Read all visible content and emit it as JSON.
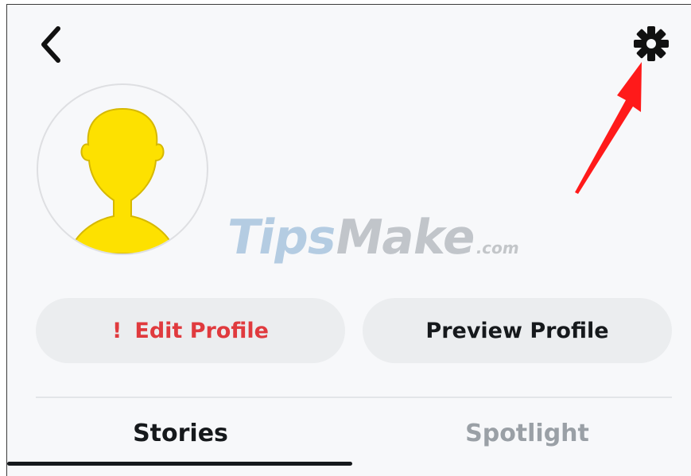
{
  "header": {
    "back_icon": "chevron-left-icon",
    "settings_icon": "gear-icon"
  },
  "annotation": {
    "arrow_color": "#ff1a1a"
  },
  "profile": {
    "avatar_icon": "default-avatar-silhouette",
    "avatar_color": "#fde100"
  },
  "watermark": {
    "brand": "TipsMake",
    "brand_part1": "Tips",
    "brand_part2": "Make",
    "suffix": ".com"
  },
  "actions": {
    "edit_alert": "!",
    "edit_label": "Edit Profile",
    "edit_color": "#e03a3e",
    "preview_label": "Preview Profile"
  },
  "tabs": [
    {
      "label": "Stories",
      "active": true
    },
    {
      "label": "Spotlight",
      "active": false
    }
  ]
}
